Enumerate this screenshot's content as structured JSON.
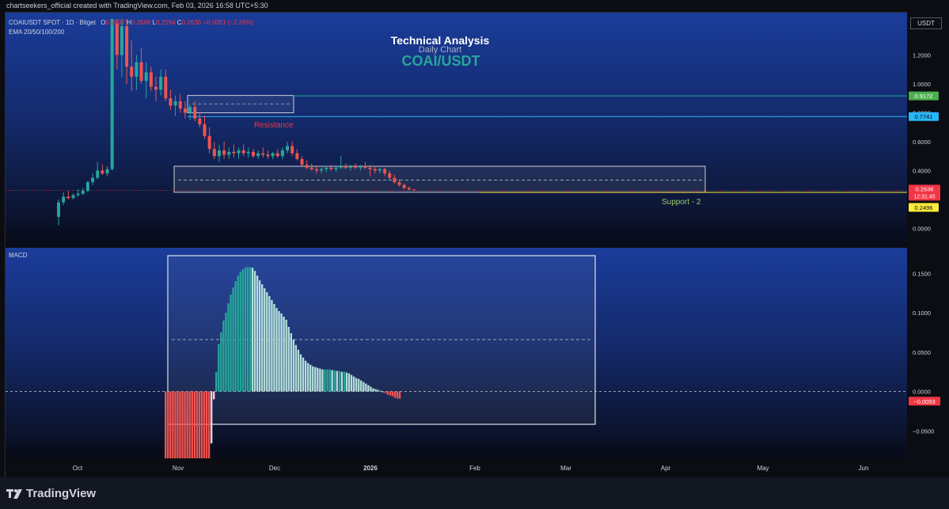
{
  "header": {
    "text": "chartseekers_official created with TradingView.com, Feb 03, 2026 16:58 UTC+5:30"
  },
  "price_pane": {
    "symbol": "COAIUSDT SPOT · 1D · Bitget",
    "ohlc": {
      "o_label": "O",
      "o": "0.2697",
      "h_label": "H",
      "h": "0.2698",
      "l_label": "L",
      "l": "0.2594",
      "c_label": "C",
      "c": "0.2636",
      "change": "−0.0061 (−2.26%)"
    },
    "indicator": "EMA 20/50/100/200",
    "currency_badge": "USDT",
    "overlay_title": "Technical Analysis",
    "overlay_subtitle": "Daily Chart",
    "overlay_pair": "COAI/USDT",
    "resistance_label": "Resistance",
    "support_label": "Support - 2",
    "axis_ticks": [
      "1.2000",
      "1.0000",
      "0.6000",
      "0.4000",
      "0.0000"
    ],
    "partial_tick": "0.8000",
    "price_tags": [
      {
        "value": "0.9172",
        "color": "#4caf50"
      },
      {
        "value": "0.7741",
        "color": "#29b6f6"
      },
      {
        "value": "0.2636",
        "color": "#f23645"
      },
      {
        "value": "12:31:45",
        "color": "#f23645"
      },
      {
        "value": "0.2496",
        "color": "#ffeb3b"
      }
    ]
  },
  "macd_pane": {
    "label": "MACD",
    "axis_ticks": [
      "0.1500",
      "0.1000",
      "0.0500",
      "0.0000",
      "−0.0500"
    ],
    "value_tag": "−0.0093"
  },
  "time_axis": [
    "Oct",
    "Nov",
    "Dec",
    "2026",
    "Feb",
    "Mar",
    "Apr",
    "May",
    "Jun"
  ],
  "footer": {
    "brand": "TradingView"
  },
  "colors": {
    "up": "#26a69a",
    "down": "#ef5350",
    "hist_up_strong": "#26a69a",
    "hist_up_weak": "#b2dfdb",
    "hist_down_strong": "#ef5350",
    "hist_down_weak": "#ffcdd2"
  },
  "chart_data": [
    {
      "type": "candlestick",
      "title": "COAIUSDT SPOT · 1D · Bitget",
      "ylim": [
        0,
        1.45
      ],
      "grid": false,
      "horizontal_levels": [
        {
          "name": "Resistance",
          "value": 0.9172
        },
        {
          "value": 0.7741
        },
        {
          "name": "Support - 2",
          "value": 0.2496
        }
      ],
      "zones": [
        {
          "name": "Resistance",
          "from": 0.8,
          "to": 0.92,
          "mid": 0.862
        },
        {
          "name": "Support - 2",
          "from": 0.25,
          "to": 0.43,
          "mid": 0.335
        }
      ],
      "ohlc_approx": [
        [
          0.08,
          0.2,
          0.02,
          0.18
        ],
        [
          0.18,
          0.25,
          0.16,
          0.22
        ],
        [
          0.22,
          0.26,
          0.2,
          0.21
        ],
        [
          0.21,
          0.24,
          0.2,
          0.23
        ],
        [
          0.23,
          0.27,
          0.22,
          0.24
        ],
        [
          0.24,
          0.28,
          0.23,
          0.26
        ],
        [
          0.26,
          0.33,
          0.25,
          0.32
        ],
        [
          0.32,
          0.38,
          0.3,
          0.35
        ],
        [
          0.35,
          0.46,
          0.34,
          0.4
        ],
        [
          0.4,
          0.44,
          0.37,
          0.38
        ],
        [
          0.38,
          0.43,
          0.36,
          0.41
        ],
        [
          0.41,
          1.45,
          0.4,
          1.45
        ],
        [
          1.42,
          1.45,
          1.1,
          1.2
        ],
        [
          1.2,
          1.45,
          1.05,
          1.4
        ],
        [
          1.4,
          1.45,
          1.0,
          1.12
        ],
        [
          1.12,
          1.3,
          0.95,
          1.05
        ],
        [
          1.05,
          1.2,
          0.96,
          1.15
        ],
        [
          1.15,
          1.25,
          1.0,
          1.02
        ],
        [
          1.02,
          1.15,
          0.9,
          1.08
        ],
        [
          1.08,
          1.12,
          0.95,
          0.98
        ],
        [
          0.98,
          1.05,
          0.88,
          0.96
        ],
        [
          0.96,
          1.1,
          0.92,
          1.05
        ],
        [
          1.05,
          1.1,
          0.88,
          0.9
        ],
        [
          0.9,
          0.96,
          0.82,
          0.85
        ],
        [
          0.85,
          0.92,
          0.78,
          0.88
        ],
        [
          0.88,
          0.93,
          0.8,
          0.83
        ],
        [
          0.83,
          0.88,
          0.76,
          0.8
        ],
        [
          0.8,
          0.86,
          0.75,
          0.84
        ],
        [
          0.84,
          0.88,
          0.74,
          0.76
        ],
        [
          0.76,
          0.8,
          0.7,
          0.72
        ],
        [
          0.72,
          0.78,
          0.62,
          0.64
        ],
        [
          0.64,
          0.7,
          0.52,
          0.55
        ],
        [
          0.55,
          0.6,
          0.48,
          0.5
        ],
        [
          0.5,
          0.58,
          0.46,
          0.54
        ],
        [
          0.54,
          0.6,
          0.48,
          0.51
        ],
        [
          0.51,
          0.56,
          0.48,
          0.53
        ],
        [
          0.53,
          0.58,
          0.49,
          0.52
        ],
        [
          0.52,
          0.56,
          0.48,
          0.54
        ],
        [
          0.54,
          0.58,
          0.5,
          0.52
        ],
        [
          0.52,
          0.56,
          0.49,
          0.53
        ],
        [
          0.53,
          0.55,
          0.49,
          0.5
        ],
        [
          0.5,
          0.54,
          0.48,
          0.52
        ],
        [
          0.52,
          0.56,
          0.49,
          0.51
        ],
        [
          0.51,
          0.54,
          0.48,
          0.5
        ],
        [
          0.5,
          0.53,
          0.48,
          0.52
        ],
        [
          0.52,
          0.55,
          0.49,
          0.5
        ],
        [
          0.5,
          0.56,
          0.48,
          0.54
        ],
        [
          0.54,
          0.6,
          0.52,
          0.57
        ],
        [
          0.57,
          0.6,
          0.5,
          0.52
        ],
        [
          0.52,
          0.55,
          0.47,
          0.48
        ],
        [
          0.48,
          0.5,
          0.43,
          0.44
        ],
        [
          0.44,
          0.47,
          0.41,
          0.42
        ],
        [
          0.42,
          0.45,
          0.4,
          0.41
        ],
        [
          0.41,
          0.43,
          0.38,
          0.4
        ],
        [
          0.4,
          0.42,
          0.38,
          0.41
        ],
        [
          0.41,
          0.43,
          0.39,
          0.42
        ],
        [
          0.42,
          0.44,
          0.4,
          0.41
        ],
        [
          0.41,
          0.43,
          0.39,
          0.42
        ],
        [
          0.42,
          0.5,
          0.41,
          0.43
        ],
        [
          0.43,
          0.45,
          0.41,
          0.42
        ],
        [
          0.42,
          0.44,
          0.4,
          0.43
        ],
        [
          0.43,
          0.45,
          0.41,
          0.42
        ],
        [
          0.42,
          0.44,
          0.4,
          0.43
        ],
        [
          0.43,
          0.46,
          0.41,
          0.42
        ],
        [
          0.42,
          0.44,
          0.36,
          0.41
        ],
        [
          0.41,
          0.43,
          0.38,
          0.4
        ],
        [
          0.4,
          0.42,
          0.38,
          0.41
        ],
        [
          0.41,
          0.42,
          0.36,
          0.38
        ],
        [
          0.38,
          0.4,
          0.34,
          0.35
        ],
        [
          0.35,
          0.37,
          0.31,
          0.32
        ],
        [
          0.32,
          0.34,
          0.29,
          0.3
        ],
        [
          0.3,
          0.31,
          0.27,
          0.28
        ],
        [
          0.28,
          0.29,
          0.26,
          0.27
        ],
        [
          0.2697,
          0.2698,
          0.2594,
          0.2636
        ]
      ]
    },
    {
      "type": "bar",
      "title": "MACD",
      "ylim": [
        -0.09,
        0.17
      ],
      "last_value": -0.0093,
      "histogram": [
        -0.09,
        -0.09,
        -0.09,
        -0.09,
        -0.09,
        -0.09,
        -0.09,
        -0.09,
        -0.09,
        -0.09,
        -0.09,
        -0.09,
        -0.09,
        -0.09,
        -0.09,
        -0.09,
        -0.09,
        -0.09,
        -0.09,
        -0.066,
        -0.01,
        0.025,
        0.06,
        0.075,
        0.09,
        0.1,
        0.112,
        0.123,
        0.132,
        0.14,
        0.147,
        0.152,
        0.155,
        0.157,
        0.158,
        0.158,
        0.157,
        0.153,
        0.147,
        0.141,
        0.136,
        0.131,
        0.126,
        0.121,
        0.116,
        0.111,
        0.106,
        0.102,
        0.099,
        0.095,
        0.091,
        0.082,
        0.074,
        0.066,
        0.059,
        0.053,
        0.047,
        0.043,
        0.039,
        0.036,
        0.034,
        0.032,
        0.031,
        0.03,
        0.029,
        0.028,
        0.028,
        0.028,
        0.028,
        0.027,
        0.027,
        0.026,
        0.026,
        0.025,
        0.025,
        0.024,
        0.023,
        0.021,
        0.019,
        0.017,
        0.016,
        0.014,
        0.012,
        0.01,
        0.008,
        0.006,
        0.004,
        0.003,
        0.002,
        0.001,
        0,
        -0.002,
        -0.004,
        -0.005,
        -0.006,
        -0.008,
        -0.009,
        -0.0093
      ]
    }
  ]
}
